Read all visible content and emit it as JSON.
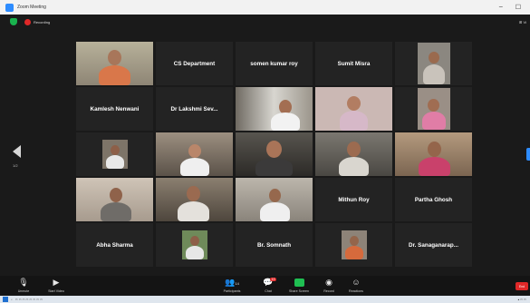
{
  "window": {
    "title": "Zoom Meeting",
    "minimize": "–",
    "maximize": "☐"
  },
  "topbar": {
    "recording": "Recording",
    "view": "⊞ Vi"
  },
  "gallery": {
    "page_left": "1/2",
    "tiles": [
      {
        "name": "",
        "type": "video",
        "active": true
      },
      {
        "name": "CS Department",
        "type": "name"
      },
      {
        "name": "somen kumar roy",
        "type": "name"
      },
      {
        "name": "Sumit Misra",
        "type": "name"
      },
      {
        "name": "",
        "type": "video-small"
      },
      {
        "name": "Kamlesh Nenwani",
        "type": "name"
      },
      {
        "name": "Dr Lakshmi Sev...",
        "type": "name"
      },
      {
        "name": "",
        "type": "video"
      },
      {
        "name": "",
        "type": "video"
      },
      {
        "name": "",
        "type": "video"
      },
      {
        "name": "",
        "type": "video-small"
      },
      {
        "name": "",
        "type": "video"
      },
      {
        "name": "",
        "type": "video"
      },
      {
        "name": "",
        "type": "video"
      },
      {
        "name": "",
        "type": "video"
      },
      {
        "name": "",
        "type": "video"
      },
      {
        "name": "",
        "type": "video"
      },
      {
        "name": "",
        "type": "video"
      },
      {
        "name": "Mithun Roy",
        "type": "name"
      },
      {
        "name": "Partha Ghosh",
        "type": "name"
      },
      {
        "name": "Abha Sharma",
        "type": "name"
      },
      {
        "name": "",
        "type": "video-small"
      },
      {
        "name": "Br. Somnath",
        "type": "name"
      },
      {
        "name": "",
        "type": "video-small"
      },
      {
        "name": "Dr. Sanaganarap...",
        "type": "name"
      }
    ]
  },
  "toolbar": {
    "unmute": "Unmute",
    "start_video": "Start Video",
    "participants": "Participants",
    "participants_count": "14",
    "chat": "Chat",
    "chat_badge": "13",
    "share_screen": "Share Screen",
    "record": "Record",
    "reactions": "Reactions",
    "end": "End"
  }
}
